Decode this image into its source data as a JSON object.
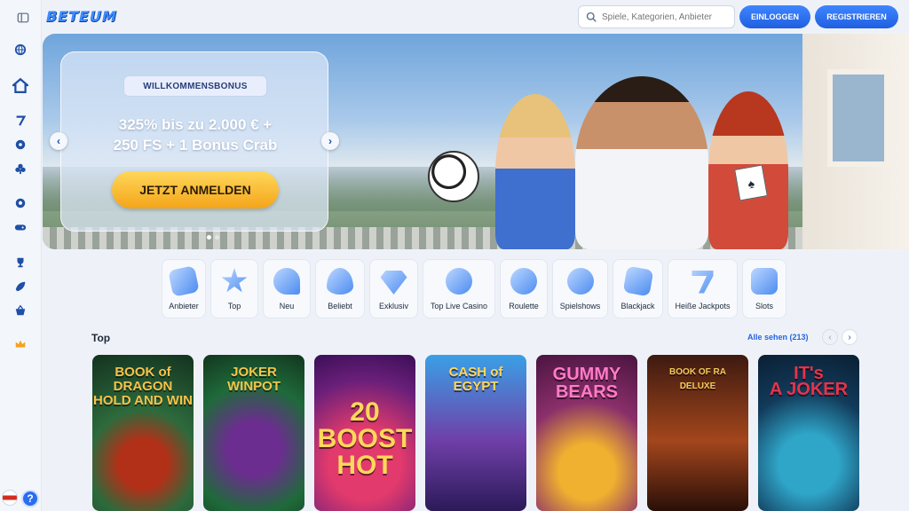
{
  "header": {
    "logo": "BETEUM",
    "search_placeholder": "Spiele, Kategorien, Anbieter",
    "login_label": "EINLOGGEN",
    "register_label": "REGISTRIEREN"
  },
  "sidebar": {
    "icons": [
      "sidebar-toggle-icon",
      "globe-icon",
      "home-icon",
      "seven-icon",
      "roulette-icon",
      "clubs-icon",
      "football-icon",
      "gamepad-icon",
      "trophy-icon",
      "rocket-icon",
      "basket-icon",
      "crown-icon"
    ],
    "help_label": "?"
  },
  "hero": {
    "badge": "WILLKOMMENSBONUS",
    "line1": "325% bis zu 2.000 € +",
    "line2": "250 FS + 1 Bonus Crab",
    "cta": "JETZT ANMELDEN",
    "slide_count": 2,
    "active_slide": 1
  },
  "categories": [
    "Anbieter",
    "Top",
    "Neu",
    "Beliebt",
    "Exklusiv",
    "Top Live Casino",
    "Roulette",
    "Spielshows",
    "Blackjack",
    "Heiße Jackpots",
    "Slots"
  ],
  "section": {
    "title": "Top",
    "see_all": "Alle sehen (213)"
  },
  "games": [
    {
      "title": "BOOK of DRAGON\nHOLD AND WIN"
    },
    {
      "title": "JOKER\nWINPOT"
    },
    {
      "title": "20\nBOOST\nHOT"
    },
    {
      "title": "CASH of\nEGYPT"
    },
    {
      "title": "GUMMY\nBEARS"
    },
    {
      "title": "BOOK OF RA\nDELUXE"
    },
    {
      "title": "IT's\nA JOKER"
    }
  ],
  "colors": {
    "accent": "#1f5fe0",
    "cta": "#f4a51a",
    "background": "#eef2f8"
  }
}
